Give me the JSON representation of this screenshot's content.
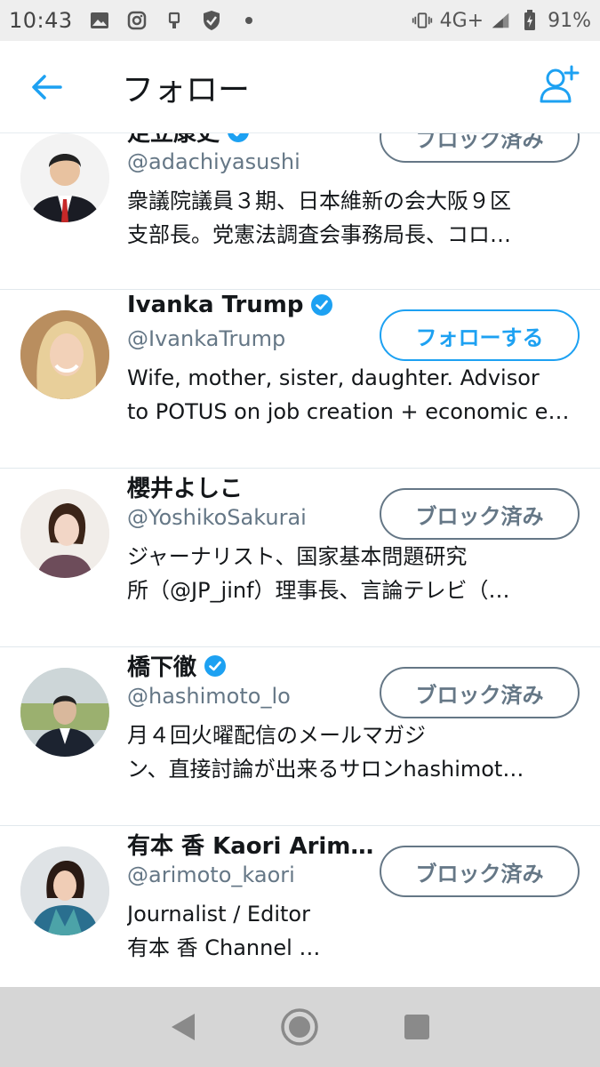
{
  "status_bar": {
    "time": "10:43",
    "network": "4G+",
    "battery": "91%",
    "icons": [
      "image-icon",
      "instagram-icon",
      "usb-icon",
      "shield-icon",
      "dot-icon",
      "vibrate-icon",
      "signal-icon",
      "battery-icon"
    ]
  },
  "header": {
    "title": "フォロー",
    "back_icon": "arrow-left-icon",
    "add_user_icon": "add-user-icon"
  },
  "colors": {
    "accent": "#1da1f2",
    "muted": "#657786",
    "text": "#14171a",
    "divider": "#e1e8ed"
  },
  "users": [
    {
      "name": "足立康史",
      "verified": true,
      "handle": "@adachiyasushi",
      "bio": [
        "衆議院議員３期、日本維新の会大阪９区",
        "支部長。党憲法調査会事務局長、コロ…"
      ],
      "button": "ブロック済み",
      "button_type": "blocked"
    },
    {
      "name": "Ivanka Trump",
      "verified": true,
      "handle": "@IvankaTrump",
      "bio": [
        "Wife, mother, sister, daughter. Advisor",
        "to POTUS on job creation + economic e…"
      ],
      "button": "フォローする",
      "button_type": "follow"
    },
    {
      "name": "櫻井よしこ",
      "verified": false,
      "handle": "@YoshikoSakurai",
      "bio": [
        "ジャーナリスト、国家基本問題研究",
        "所（@JP_jinf）理事長、言論テレビ（…"
      ],
      "button": "ブロック済み",
      "button_type": "blocked"
    },
    {
      "name": "橋下徹",
      "verified": true,
      "handle": "@hashimoto_lo",
      "bio": [
        "月４回火曜配信のメールマガジ",
        "ン、直接討論が出来るサロンhashimot…"
      ],
      "button": "ブロック済み",
      "button_type": "blocked"
    },
    {
      "name": "有本 香 Kaori Arimo…",
      "verified": false,
      "handle": "@arimoto_kaori",
      "bio": [
        "Journalist / Editor",
        "有本 香 Channel …"
      ],
      "button": "ブロック済み",
      "button_type": "blocked"
    }
  ],
  "nav_bar": {
    "back": "triangle-back-icon",
    "home": "circle-home-icon",
    "recents": "square-recents-icon"
  }
}
